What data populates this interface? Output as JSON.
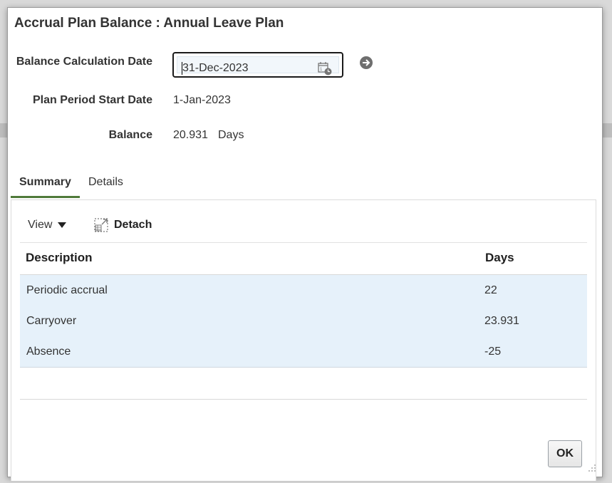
{
  "dialog": {
    "title": "Accrual Plan Balance : Annual Leave Plan"
  },
  "form": {
    "balance_date_label": "Balance Calculation Date",
    "balance_date_value": "31-Dec-2023",
    "period_start_label": "Plan Period Start Date",
    "period_start_value": "1-Jan-2023",
    "balance_label": "Balance",
    "balance_value": "20.931",
    "balance_unit": "Days"
  },
  "tabs": [
    {
      "label": "Summary",
      "active": true
    },
    {
      "label": "Details",
      "active": false
    }
  ],
  "toolbar": {
    "view_label": "View",
    "detach_label": "Detach"
  },
  "table": {
    "columns": [
      "Description",
      "Days"
    ],
    "rows": [
      {
        "description": "Periodic accrual",
        "days": "22"
      },
      {
        "description": "Carryover",
        "days": "23.931"
      },
      {
        "description": "Absence",
        "days": "-25"
      }
    ]
  },
  "footer": {
    "ok_label": "OK"
  },
  "colors": {
    "active_tab_underline": "#4f7a3a",
    "selected_rows_bg": "#e6f1fa"
  },
  "icons": [
    "calendar-icon",
    "go-arrow-icon",
    "caret-down-icon",
    "detach-icon",
    "resize-grip-icon"
  ]
}
